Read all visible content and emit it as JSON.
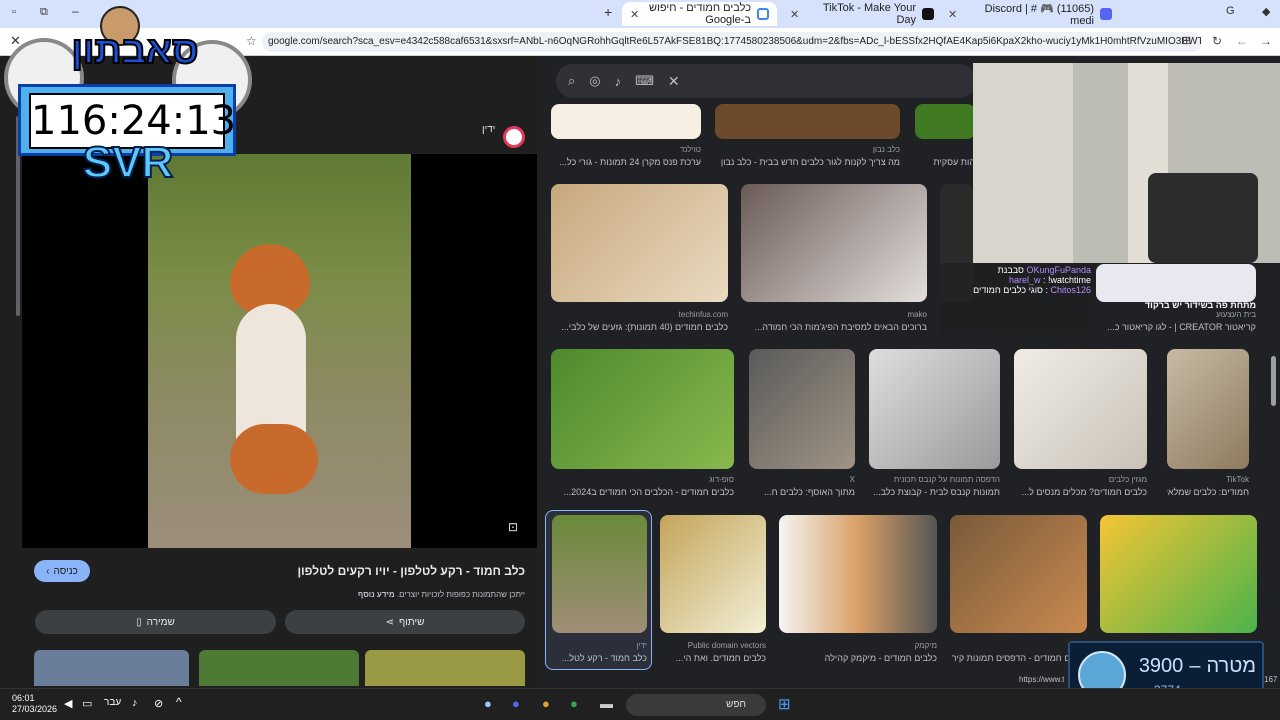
{
  "tabs": [
    {
      "title": "כלבים חמודים - חיפוש ב-Google",
      "active": true
    },
    {
      "title": "TikTok - Make Your Day",
      "active": false
    },
    {
      "title": "(11065) Discord | # 🎮 medi",
      "active": false
    }
  ],
  "address": {
    "url": "google.com/search?sca_esv=e4342c588caf6531&sxsrf=ANbL-n6OqNGRohhGqltRe6L57AkFSE81BQ:1774580238506&udm=2&fbs=ADc_l-bESSfx2HQfAE4Kap5i6KpaX2kho-wuciy1yMk1H0mhtRfVzuMIO3BWTNHFOJy1eSv..."
  },
  "stream_overlay": {
    "timer": "116:24:13",
    "tag": "SVR",
    "logo_text": "סאבתון"
  },
  "preview": {
    "site_name": "ידין",
    "title": "כלב חמוד - רקע לטלפון - יויו רקעים לטלפון",
    "notice": "ייתכן שהתמונות כפופות לזכויות יוצרים.",
    "notice_more": "מידע נוסף",
    "visit_label": "כניסה",
    "share_label": "שיתוף",
    "save_label": "שמירה"
  },
  "results": [
    {
      "src": "טוילנד",
      "cap": "ערכת פנס מקרן 24 תמונות - גורי כל..."
    },
    {
      "src": "כלב נבון",
      "cap": "מה צריך לקנות לגור כלבים חדש בבית - כלב נבון"
    },
    {
      "src": "",
      "cap": "הות עסקית"
    },
    {
      "src": "techinfus.com",
      "cap": "כלבים חמודים (40 תמונות): גזעים של כלבי..."
    },
    {
      "src": "mako",
      "cap": "ברוכים הבאים למסיבת הפיג'מות הכי חמודה..."
    },
    {
      "src": "בית העצעוע",
      "cap": "קריאטור CREATOR | - לגו קריאטור כ..."
    },
    {
      "src": "סופ-דוג",
      "cap": "כלבים חמודים - הכלבים הכי חמודים ב2024..."
    },
    {
      "src": "X",
      "cap": "מתוך האוסף: כלבים ח..."
    },
    {
      "src": "הדפסה תמונות על קנבס תכונית",
      "cap": "תמונות קנבס לבית - קבוצת כלב..."
    },
    {
      "src": "מגזין כלבים",
      "cap": "כלבים חמודים? מכלים מנסים ל..."
    },
    {
      "src": "TikTok",
      "cap": "חמודים: כלבים שמלאי..."
    },
    {
      "src": "ידין",
      "cap": "כלב חמוד - רקע לטל..."
    },
    {
      "src": "Public domain vectors",
      "cap": "כלבים חמודים. ואת הי..."
    },
    {
      "src": "מיקמק",
      "cap": "כלבים חמודים - מיקמק קהילה"
    },
    {
      "src": "לד",
      "cap": "כלבים חמודים - הדפסים תמונות קיר פוס..."
    }
  ],
  "chat": [
    {
      "user": "OKungFuPanda",
      "msg": "סבבנת"
    },
    {
      "user": "harel_w",
      "msg": "!watchtime"
    },
    {
      "user": "Chitos126",
      "msg": "סוגי כלבים חמודים"
    },
    {
      "user": "",
      "msg": "מתחת פה בשידור יש ברקוד"
    }
  ],
  "goal": {
    "label": "מטרה",
    "target": "3900",
    "current": "3774"
  },
  "status_url": "https://www.t",
  "status_num": "167",
  "taskbar": {
    "time": "06:01",
    "date": "27/03/2026",
    "lang": "עבר",
    "search": "חפש"
  }
}
